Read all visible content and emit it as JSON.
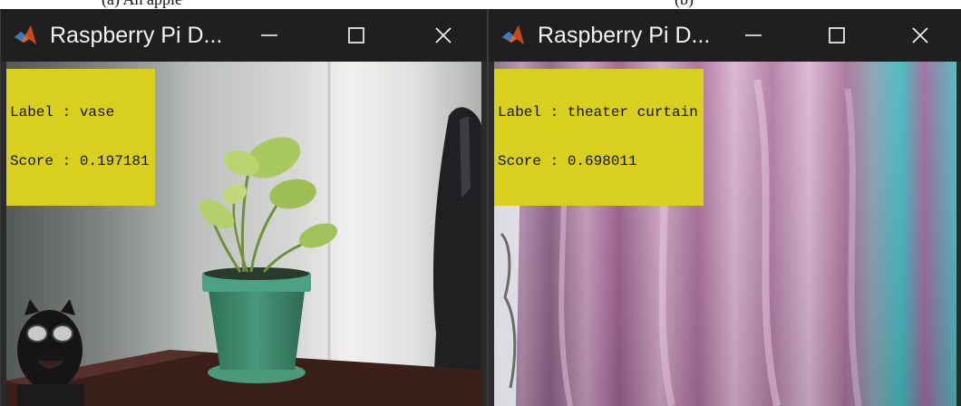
{
  "windows": [
    {
      "title": "Raspberry Pi D...",
      "controls": {
        "minimize_icon": "minimize-icon",
        "maximize_icon": "maximize-icon",
        "close_icon": "close-icon"
      },
      "overlay": {
        "label_line": "Label : vase",
        "score_line": "Score : 0.197181"
      }
    },
    {
      "title": "Raspberry Pi D...",
      "controls": {
        "minimize_icon": "minimize-icon",
        "maximize_icon": "maximize-icon",
        "close_icon": "close-icon"
      },
      "overlay": {
        "label_line": "Label : theater curtain",
        "score_line": "Score : 0.698011"
      }
    }
  ],
  "colors": {
    "titlebar": "#1f1f1f",
    "overlay_bg": "#d8cf1e",
    "pot_green": "#3f8f6a",
    "curtain_pink": "#b56a9a",
    "curtain_teal": "#3fb9bf"
  }
}
